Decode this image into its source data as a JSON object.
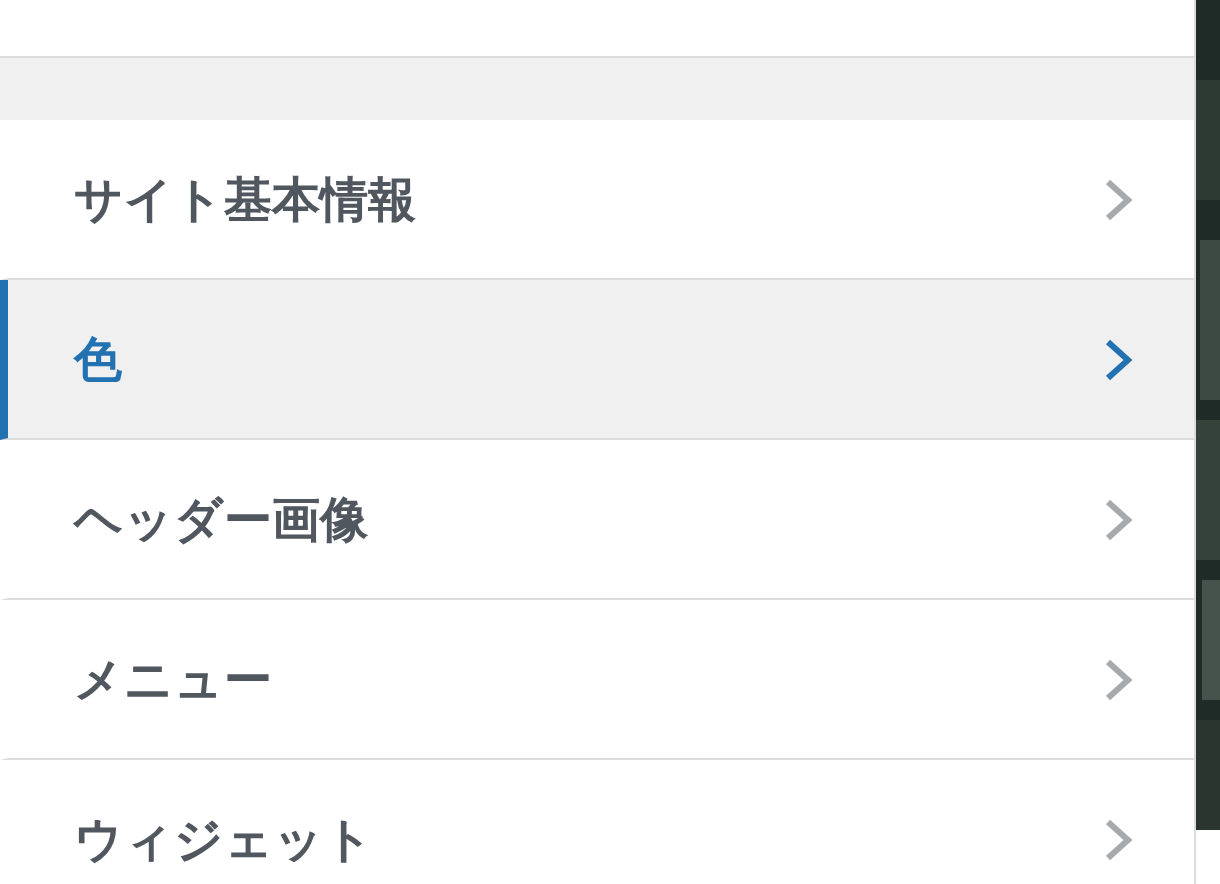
{
  "menu": {
    "items": [
      {
        "label": "サイト基本情報",
        "selected": false
      },
      {
        "label": "色",
        "selected": true
      },
      {
        "label": "ヘッダー画像",
        "selected": false
      },
      {
        "label": "メニュー",
        "selected": false
      },
      {
        "label": "ウィジェット",
        "selected": false
      }
    ]
  }
}
